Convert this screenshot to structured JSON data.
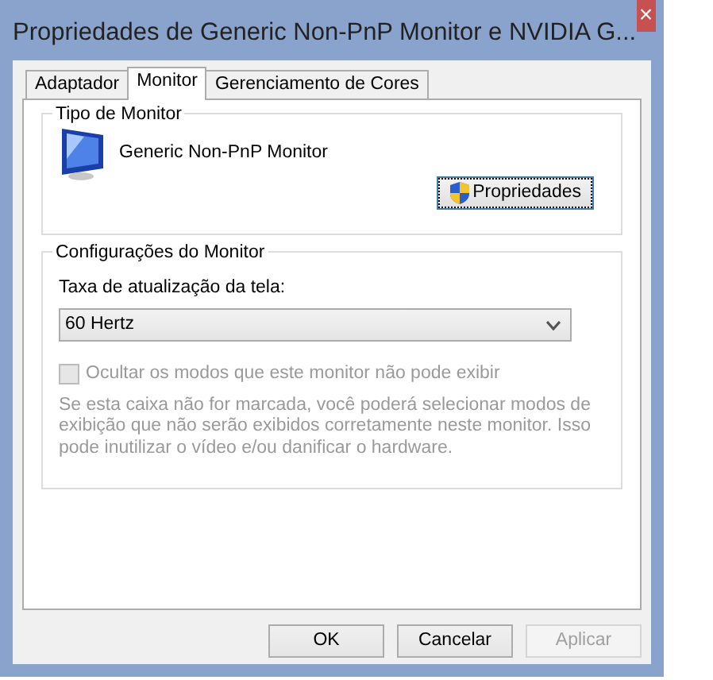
{
  "window": {
    "title": "Propriedades de Generic Non-PnP Monitor e NVIDIA G...",
    "close": "×"
  },
  "tabs": [
    {
      "label": "Adaptador",
      "selected": false
    },
    {
      "label": "Monitor",
      "selected": true
    },
    {
      "label": "Gerenciamento de Cores",
      "selected": false
    }
  ],
  "monitor_type": {
    "title": "Tipo de Monitor",
    "name": "Generic Non-PnP Monitor",
    "button": "Propriedades"
  },
  "monitor_settings": {
    "title": "Configurações do Monitor",
    "refresh_label": "Taxa de atualização da tela:",
    "refresh_value": "60 Hertz",
    "checkbox": {
      "label": "Ocultar os modos que este monitor não pode exibir",
      "checked": false,
      "disabled": true
    },
    "note": "Se esta caixa não for marcada, você poderá selecionar modos de exibição que não serão exibidos corretamente neste monitor. Isso pode inutilizar o vídeo e/ou danificar o hardware."
  },
  "buttons": [
    {
      "label": "OK",
      "disabled": false
    },
    {
      "label": "Cancelar",
      "disabled": false
    },
    {
      "label": "Aplicar",
      "disabled": true
    }
  ]
}
